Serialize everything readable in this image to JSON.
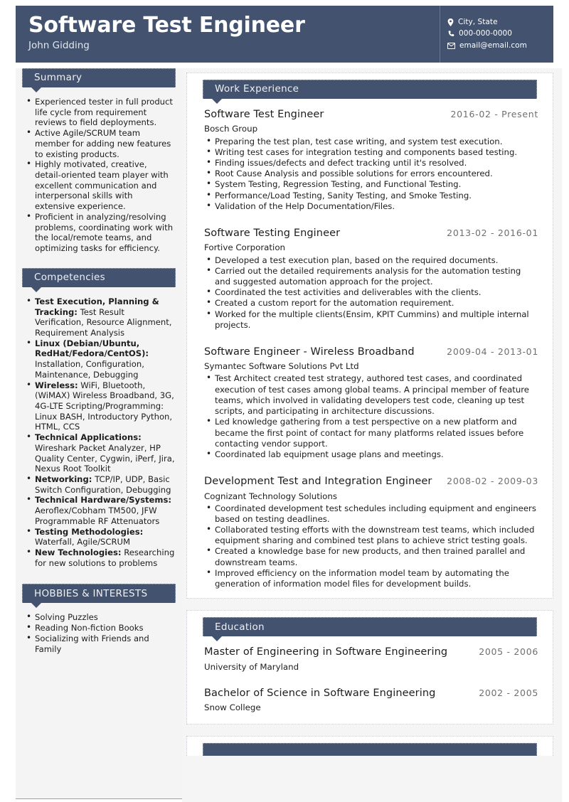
{
  "header": {
    "job_title": "Software Test Engineer",
    "name": "John Gidding",
    "contact": {
      "location": "City, State",
      "phone": "000-000-0000",
      "email": "email@email.com"
    }
  },
  "theme": {
    "accent": "#43536f",
    "sidebar_bg": "#f4f4f4",
    "page_bg": "#f5f5f5",
    "card_bg": "#ffffff",
    "text": "#1d1d1d",
    "muted": "#6f6f6f"
  },
  "sidebar": {
    "summary": {
      "heading": "Summary",
      "items": [
        "Experienced tester in full product life cycle from requirement reviews to field deployments.",
        "Active Agile/SCRUM team member for adding new features to existing products.",
        "Highly motivated, creative, detail-oriented team player with excellent communication and interpersonal skills with extensive experience.",
        "Proficient in analyzing/resolving problems, coordinating work with the local/remote teams, and optimizing tasks for efficiency."
      ]
    },
    "competencies": {
      "heading": "Competencies",
      "items": [
        {
          "label": "Test Execution, Planning & Tracking:",
          "value": " Test Result Verification, Resource Alignment, Requirement Analysis"
        },
        {
          "label": "Linux (Debian/Ubuntu, RedHat/Fedora/CentOS):",
          "value": " Installation, Configuration, Maintenance, Debugging"
        },
        {
          "label": "Wireless:",
          "value": " WiFi, Bluetooth, (WiMAX) Wireless Broadband, 3G, 4G-LTE Scripting/Programming: Linux BASH, Introductory Python, HTML, CCS"
        },
        {
          "label": "Technical Applications:",
          "value": " Wireshark Packet Analyzer, HP Quality Center, Cygwin, iPerf, Jira, Nexus Root Toolkit"
        },
        {
          "label": "Networking:",
          "value": " TCP/IP, UDP, Basic Switch Configuration, Debugging"
        },
        {
          "label": "Technical Hardware/Systems:",
          "value": " Aeroflex/Cobham TM500, JFW Programmable RF Attenuators"
        },
        {
          "label": "Testing Methodologies:",
          "value": " Waterfall, Agile/SCRUM"
        },
        {
          "label": "New Technologies:",
          "value": " Researching for new solutions to problems"
        }
      ]
    },
    "hobbies": {
      "heading": "HOBBIES & INTERESTS",
      "items": [
        "Solving Puzzles",
        "Reading Non-fiction Books",
        "Socializing with Friends and Family"
      ]
    }
  },
  "main": {
    "work": {
      "heading": "Work Experience",
      "entries": [
        {
          "title": "Software Test Engineer",
          "date": "2016-02 - Present",
          "org": "Bosch Group",
          "duties": [
            "Preparing the test plan, test case writing, and system test execution.",
            "Writing test cases for integration testing and components based testing.",
            "Finding issues/defects and defect tracking until it's resolved.",
            "Root Cause Analysis and possible solutions for errors encountered.",
            "System Testing, Regression Testing, and Functional Testing.",
            "Performance/Load Testing, Sanity Testing, and Smoke Testing.",
            "Validation of the Help Documentation/Files."
          ]
        },
        {
          "title": "Software Testing Engineer",
          "date": "2013-02 - 2016-01",
          "org": "Fortive Corporation",
          "duties": [
            "Developed a test execution plan, based on the required documents.",
            "Carried out the detailed requirements analysis for the automation testing and suggested automation approach for the project.",
            "Coordinated the test activities and deliverables with the clients.",
            "Created a custom report for the automation requirement.",
            "Worked for the multiple clients(Ensim, KPIT Cummins) and multiple internal projects."
          ]
        },
        {
          "title": "Software Engineer - Wireless Broadband",
          "date": "2009-04 - 2013-01",
          "org": "Symantec Software Solutions Pvt Ltd",
          "duties": [
            "Test Architect created test strategy, authored test cases, and coordinated execution of test cases among global teams. A principal member of feature teams, which involved in validating developers test code, cleaning up test scripts, and participating in architecture discussions.",
            "Led knowledge gathering from a test perspective on a new platform and became the first point of contact for many platforms related issues before contacting vendor support.",
            "Coordinated lab equipment usage plans and meetings."
          ]
        },
        {
          "title": "Development Test and Integration Engineer",
          "date": "2008-02 - 2009-03",
          "org": "Cognizant Technology Solutions",
          "duties": [
            "Coordinated development test schedules including equipment and engineers based on testing deadlines.",
            "Collaborated testing efforts with the downstream test teams, which included equipment sharing and combined test plans to achieve strict testing goals.",
            "Created a knowledge base for new products, and then trained parallel and downstream teams.",
            "Improved efficiency on the information model team by automating the generation of information model files for development builds."
          ]
        }
      ]
    },
    "education": {
      "heading": "Education",
      "entries": [
        {
          "degree": "Master of Engineering in Software Engineering",
          "date": "2005 - 2006",
          "school": "University of Maryland"
        },
        {
          "degree": "Bachelor of Science in Software Engineering",
          "date": "2002 - 2005",
          "school": "Snow College"
        }
      ]
    }
  }
}
